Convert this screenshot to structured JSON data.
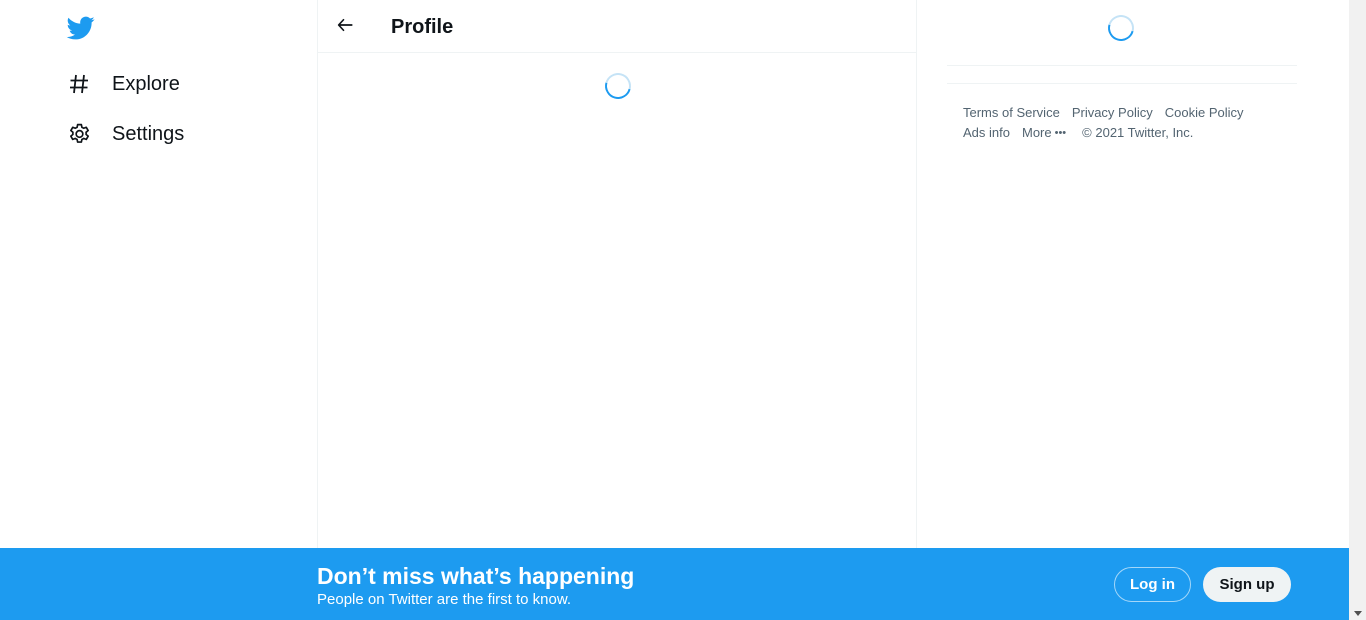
{
  "nav": {
    "logo_icon": "twitter-bird-icon",
    "items": [
      {
        "label": "Explore",
        "icon": "hashtag-icon"
      },
      {
        "label": "Settings",
        "icon": "gear-icon"
      }
    ]
  },
  "main": {
    "back_icon": "back-arrow-icon",
    "title": "Profile"
  },
  "side": {
    "footer": {
      "terms": "Terms of Service",
      "privacy": "Privacy Policy",
      "cookie": "Cookie Policy",
      "ads": "Ads info",
      "more": "More",
      "more_icon": "more-dots-icon",
      "copyright": "© 2021 Twitter, Inc."
    }
  },
  "banner": {
    "title": "Don’t miss what’s happening",
    "subtitle": "People on Twitter are the first to know.",
    "login_label": "Log in",
    "signup_label": "Sign up"
  },
  "colors": {
    "accent": "#1d9bf0",
    "text": "#0f1419",
    "muted": "#536471",
    "border": "#eff3f4"
  }
}
